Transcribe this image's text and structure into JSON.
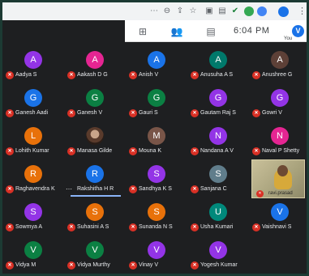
{
  "browser": {
    "icons": [
      "menu-dots-icon",
      "zoom-icon",
      "share-icon",
      "star-icon",
      "screenshot-icon",
      "tab-icon",
      "check-extension-icon",
      "green-extension-icon",
      "blue-extension-icon",
      "profile-icon",
      "kebab-menu-icon"
    ]
  },
  "meet_bar": {
    "time": "6:04 PM",
    "you_label": "You",
    "avatar_letter": "V"
  },
  "participants": [
    {
      "initial": "A",
      "name": "Aadya S",
      "color": "#9334e6"
    },
    {
      "initial": "A",
      "name": "Aakash D G",
      "color": "#e52592"
    },
    {
      "initial": "A",
      "name": "Anish V",
      "color": "#1a73e8"
    },
    {
      "initial": "A",
      "name": "Anusuha A S",
      "color": "#00796b"
    },
    {
      "initial": "A",
      "name": "Anushree G",
      "color": "#5d4037"
    },
    {
      "initial": "G",
      "name": "Ganesh Aadi",
      "color": "#1a73e8"
    },
    {
      "initial": "G",
      "name": "Ganesh V",
      "color": "#0b8043"
    },
    {
      "initial": "G",
      "name": "Gauri S",
      "color": "#0b8043"
    },
    {
      "initial": "G",
      "name": "Gautam Raj S",
      "color": "#9334e6"
    },
    {
      "initial": "G",
      "name": "Gowri V",
      "color": "#9334e6"
    },
    {
      "initial": "L",
      "name": "Lohith Kumar",
      "color": "#e8710a"
    },
    {
      "initial": "",
      "name": "Manasa Gilde",
      "color": "",
      "photo": true
    },
    {
      "initial": "M",
      "name": "Mouna K",
      "color": "#795548"
    },
    {
      "initial": "N",
      "name": "Nandana A V",
      "color": "#9334e6"
    },
    {
      "initial": "N",
      "name": "Naval P Shetty",
      "color": "#e52592"
    },
    {
      "initial": "R",
      "name": "Raghavendra K",
      "color": "#e8710a"
    },
    {
      "initial": "R",
      "name": "Rakshitha H R",
      "color": "#1a73e8",
      "active": true
    },
    {
      "initial": "S",
      "name": "Sandhya K S",
      "color": "#9334e6"
    },
    {
      "initial": "S",
      "name": "Sanjana C",
      "color": "#607d8b"
    },
    {
      "initial": "S",
      "name": "Sowmya A",
      "color": "#9334e6"
    },
    {
      "initial": "S",
      "name": "Suhasini A S",
      "color": "#e8710a"
    },
    {
      "initial": "S",
      "name": "Sunanda N S",
      "color": "#e8710a"
    },
    {
      "initial": "U",
      "name": "Usha Kumari",
      "color": "#00897b"
    },
    {
      "initial": "V",
      "name": "Vaishnavi S",
      "color": "#1a73e8"
    },
    {
      "initial": "V",
      "name": "Vidya M",
      "color": "#0b8043"
    },
    {
      "initial": "V",
      "name": "Vidya Murthy",
      "color": "#0b8043"
    },
    {
      "initial": "V",
      "name": "Vinay V",
      "color": "#9334e6"
    },
    {
      "initial": "V",
      "name": "Yogesh Kumar",
      "color": "#9334e6"
    }
  ],
  "self_view": {
    "label": "ravi.prasad"
  }
}
